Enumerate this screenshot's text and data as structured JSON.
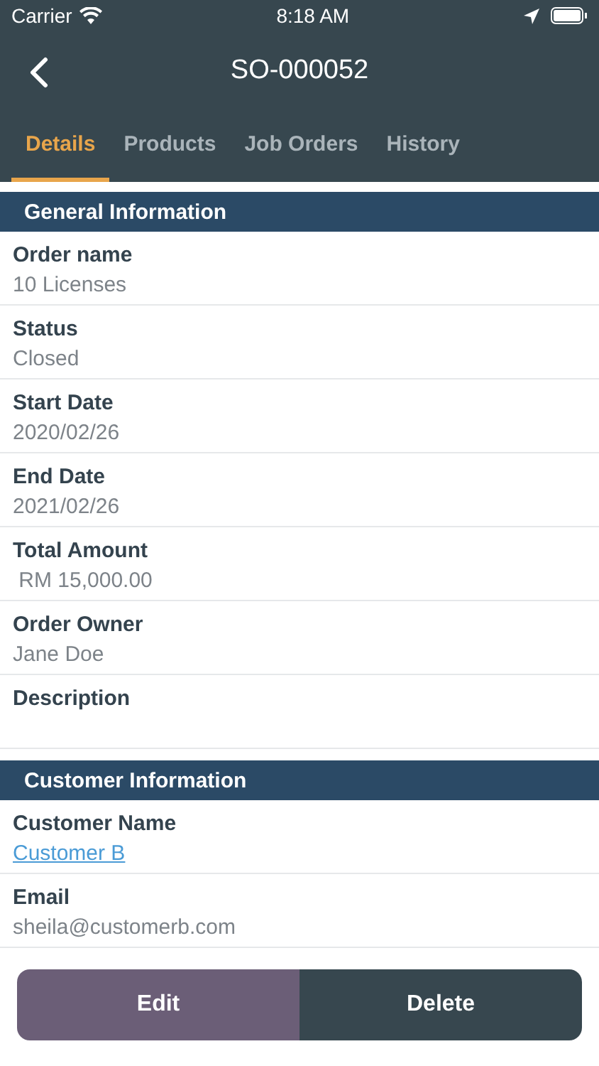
{
  "status_bar": {
    "carrier": "Carrier",
    "time": "8:18 AM"
  },
  "nav": {
    "title": "SO-000052"
  },
  "tabs": [
    {
      "label": "Details",
      "selected": true
    },
    {
      "label": "Products",
      "selected": false
    },
    {
      "label": "Job Orders",
      "selected": false
    },
    {
      "label": "History",
      "selected": false
    }
  ],
  "sections": [
    {
      "title": "General Information",
      "fields": [
        {
          "label": "Order name",
          "value": "10 Licenses"
        },
        {
          "label": "Status",
          "value": "Closed"
        },
        {
          "label": "Start Date",
          "value": "2020/02/26"
        },
        {
          "label": "End Date",
          "value": "2021/02/26"
        },
        {
          "label": "Total Amount",
          "value": " RM 15,000.00"
        },
        {
          "label": "Order Owner",
          "value": "Jane Doe"
        },
        {
          "label": "Description"
        }
      ]
    },
    {
      "title": "Customer Information",
      "fields": [
        {
          "label": "Customer Name",
          "value": "Customer B",
          "kind": "link"
        },
        {
          "label": "Email",
          "value": "sheila@customerb.com"
        }
      ]
    }
  ],
  "actions": [
    {
      "label": "Edit",
      "kind": "edit"
    },
    {
      "label": "Delete",
      "kind": "delete"
    }
  ]
}
